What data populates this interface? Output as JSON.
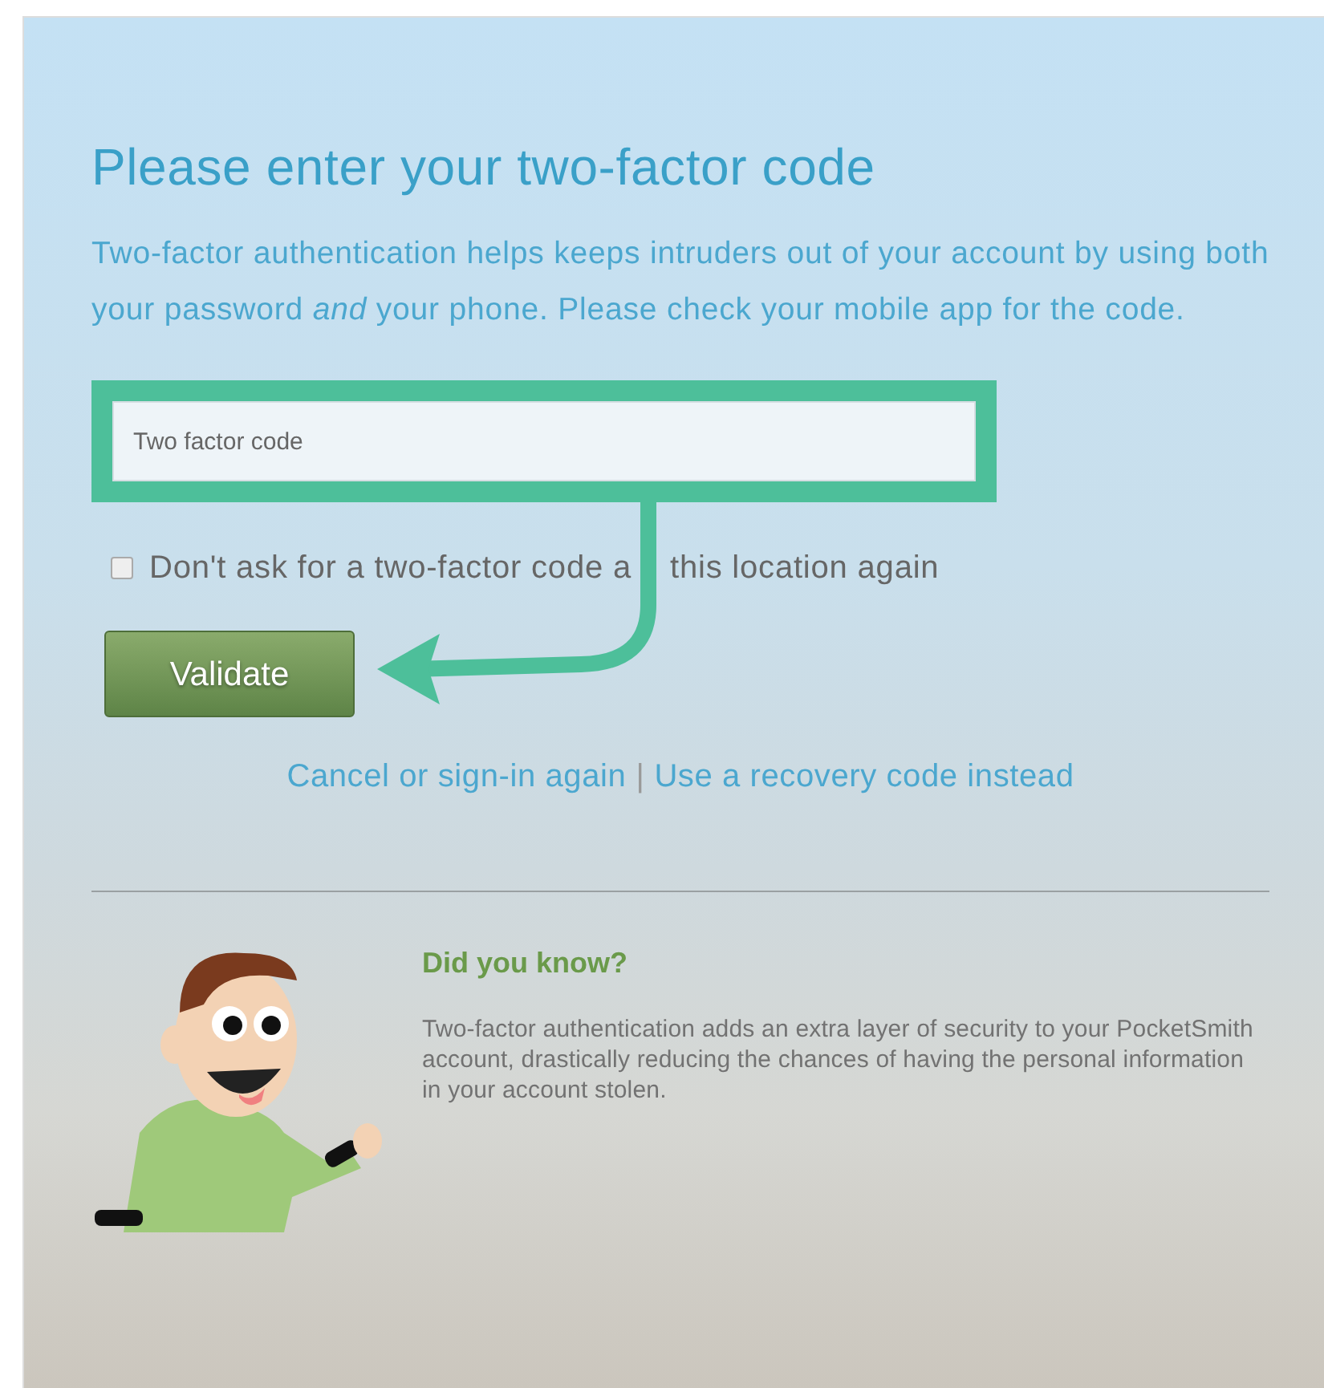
{
  "heading": "Please enter your two-factor code",
  "intro": "Two-factor authentication helps keeps intruders out of your account by using both your password *and* your phone. Please check your mobile app for the code.",
  "code_field": {
    "placeholder": "Two factor code"
  },
  "remember": {
    "label": "Don't ask for a two-factor code a",
    "label_after_arrow": "this location again",
    "checked": false
  },
  "validate_button": "Validate",
  "links": [
    {
      "label": "Cancel or sign-in again"
    },
    {
      "label": "Use a recovery code instead"
    }
  ],
  "link_separator": "|",
  "tip": {
    "title": "Did you know?",
    "text": "Two-factor authentication adds an extra layer of security to your PocketSmith account, drastically reducing the chances of having the personal information in your account stolen."
  }
}
